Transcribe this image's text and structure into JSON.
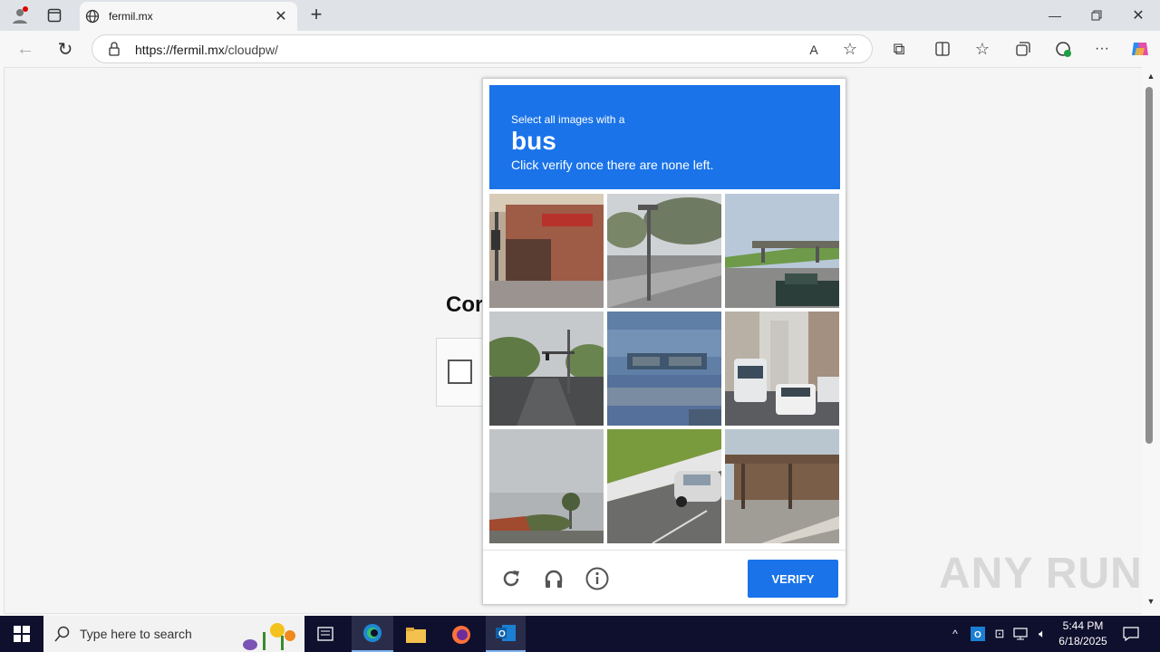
{
  "browser": {
    "tab_title": "fermil.mx",
    "url_host": "https://fermil.mx",
    "url_path": "/cloudpw/"
  },
  "page": {
    "title_partial": "Cor"
  },
  "captcha": {
    "prompt_small": "Select all images with a",
    "prompt_object": "bus",
    "prompt_hint": "Click verify once there are none left.",
    "verify_label": "VERIFY",
    "tiles": [
      "storefront",
      "street-corner",
      "overpass-highway",
      "intersection",
      "overhead-sign",
      "city-traffic-bus",
      "palm-street",
      "car-road",
      "bridge"
    ]
  },
  "taskbar": {
    "search_placeholder": "Type here to search",
    "time": "5:44 PM",
    "date": "6/18/2025"
  },
  "watermark": "ANY RUN",
  "colors": {
    "accent": "#1a73e8"
  }
}
